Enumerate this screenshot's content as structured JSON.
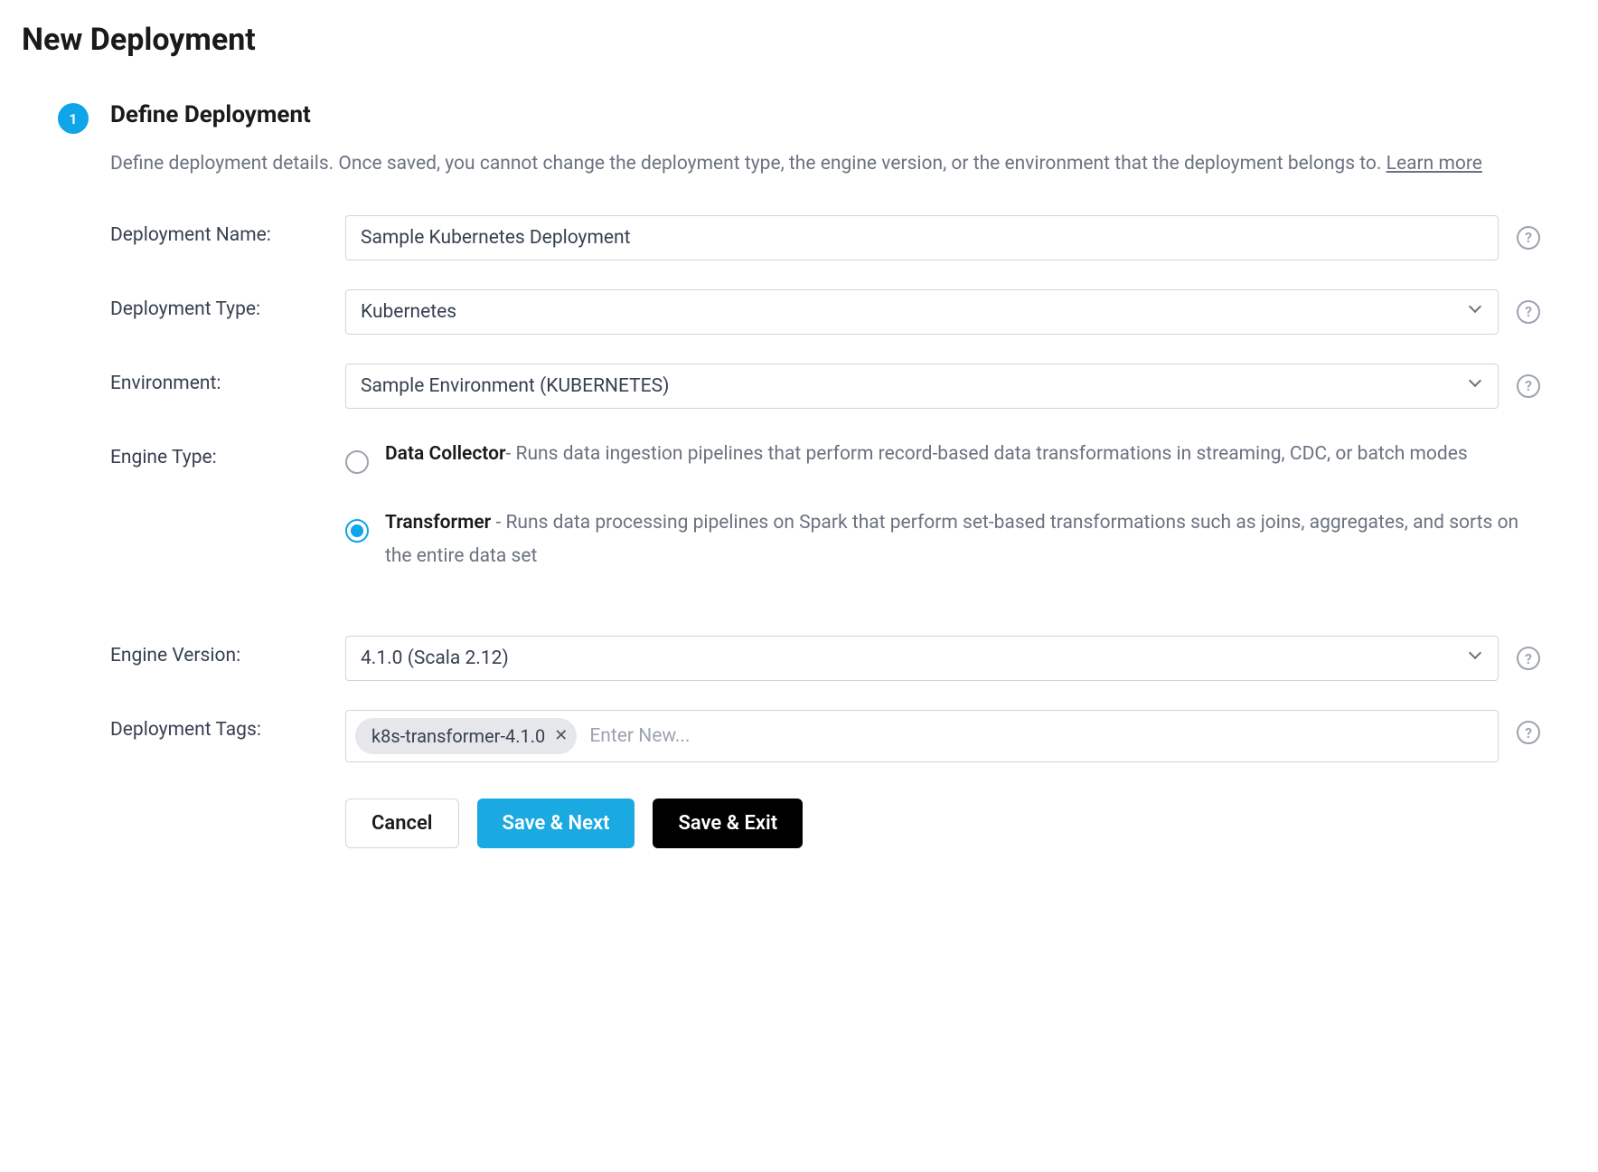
{
  "page_title": "New Deployment",
  "step": {
    "number": "1",
    "title": "Define Deployment",
    "description": "Define deployment details. Once saved, you cannot change the deployment type, the engine version, or the environment that the deployment belongs to. ",
    "learn_more": "Learn more"
  },
  "fields": {
    "deployment_name": {
      "label": "Deployment Name:",
      "value": "Sample Kubernetes Deployment"
    },
    "deployment_type": {
      "label": "Deployment Type:",
      "value": "Kubernetes"
    },
    "environment": {
      "label": "Environment:",
      "value": "Sample Environment (KUBERNETES)"
    },
    "engine_type": {
      "label": "Engine Type:",
      "options": [
        {
          "title": "Data Collector",
          "desc": "- Runs data ingestion pipelines that perform record-based data transformations in streaming, CDC, or batch modes",
          "selected": false
        },
        {
          "title": "Transformer ",
          "desc": "- Runs data processing pipelines on Spark that perform set-based transformations such as joins, aggregates, and sorts on the entire data set",
          "selected": true
        }
      ]
    },
    "engine_version": {
      "label": "Engine Version:",
      "value": "4.1.0 (Scala 2.12)"
    },
    "deployment_tags": {
      "label": "Deployment Tags:",
      "tags": [
        "k8s-transformer-4.1.0"
      ],
      "placeholder": "Enter New..."
    }
  },
  "buttons": {
    "cancel": "Cancel",
    "save_next": "Save & Next",
    "save_exit": "Save & Exit"
  }
}
